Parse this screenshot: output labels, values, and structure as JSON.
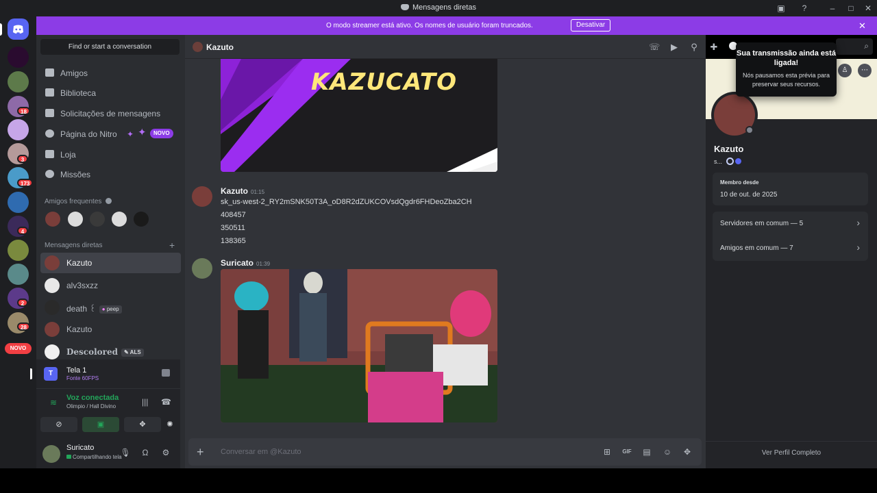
{
  "window": {
    "title": "Mensagens diretas"
  },
  "banner": {
    "message": "O modo streamer está ativo. Os nomes de usuário foram truncados.",
    "button": "Desativar"
  },
  "servers": {
    "badges": [
      "18",
      "3",
      "173",
      "4",
      "2",
      "28"
    ],
    "novo": "NOVO"
  },
  "sidebar": {
    "search_placeholder": "Find or start a conversation",
    "nav": [
      {
        "label": "Amigos",
        "icon": "friends-icon"
      },
      {
        "label": "Biblioteca",
        "icon": "library-icon"
      },
      {
        "label": "Solicitações de mensagens",
        "icon": "envelope-icon"
      },
      {
        "label": "Página do Nitro",
        "icon": "nitro-icon"
      },
      {
        "label": "Loja",
        "icon": "shop-icon"
      },
      {
        "label": "Missões",
        "icon": "quests-icon"
      }
    ],
    "nitro_badge": "NOVO",
    "frequent_header": "Amigos frequentes",
    "dm_header": "Mensagens diretas",
    "dms": [
      {
        "name": "Kazuto",
        "active": true
      },
      {
        "name": "alv3sxzz"
      },
      {
        "name": "death ꒰",
        "tag": "peep"
      },
      {
        "name": "Kazuto"
      },
      {
        "name": "Descolored",
        "tag": "ALS"
      }
    ]
  },
  "panel": {
    "stream_title": "Tela 1",
    "stream_sub": "Fonte 60FPS",
    "voice_status": "Voz conectada",
    "voice_channel": "Olimpio / Hall Divino",
    "user_name": "Suricato",
    "user_status": "Compartilhando tela"
  },
  "chat": {
    "recipient": "Kazuto",
    "image_text": "KAZUCATO",
    "messages": [
      {
        "author": "Kazuto",
        "time": "01:15",
        "lines": [
          "sk_us-west-2_RY2mSNK50T3A_oD8R2dZUKCOVsdQgdr6FHDeoZba2CH",
          "408457",
          "350511",
          "138365"
        ]
      },
      {
        "author": "Suricato",
        "time": "01:39"
      }
    ],
    "composer_placeholder": "Conversar em @Kazuto"
  },
  "profile": {
    "name": "Kazuto",
    "status": "s...",
    "member_since_label": "Membro desde",
    "member_since": "10 de out. de 2025",
    "servers_common": "Servidores em comum — 5",
    "friends_common": "Amigos em comum — 7",
    "full_profile": "Ver Perfil Completo"
  },
  "toast": {
    "title": "Sua transmissão ainda está ligada!",
    "body": "Nós pausamos esta prévia para preservar seus recursos."
  },
  "colors": {
    "banner": "#8c3ce6",
    "blurple": "#5865f2",
    "voice_green": "#23a55a",
    "danger": "#f23f43"
  }
}
